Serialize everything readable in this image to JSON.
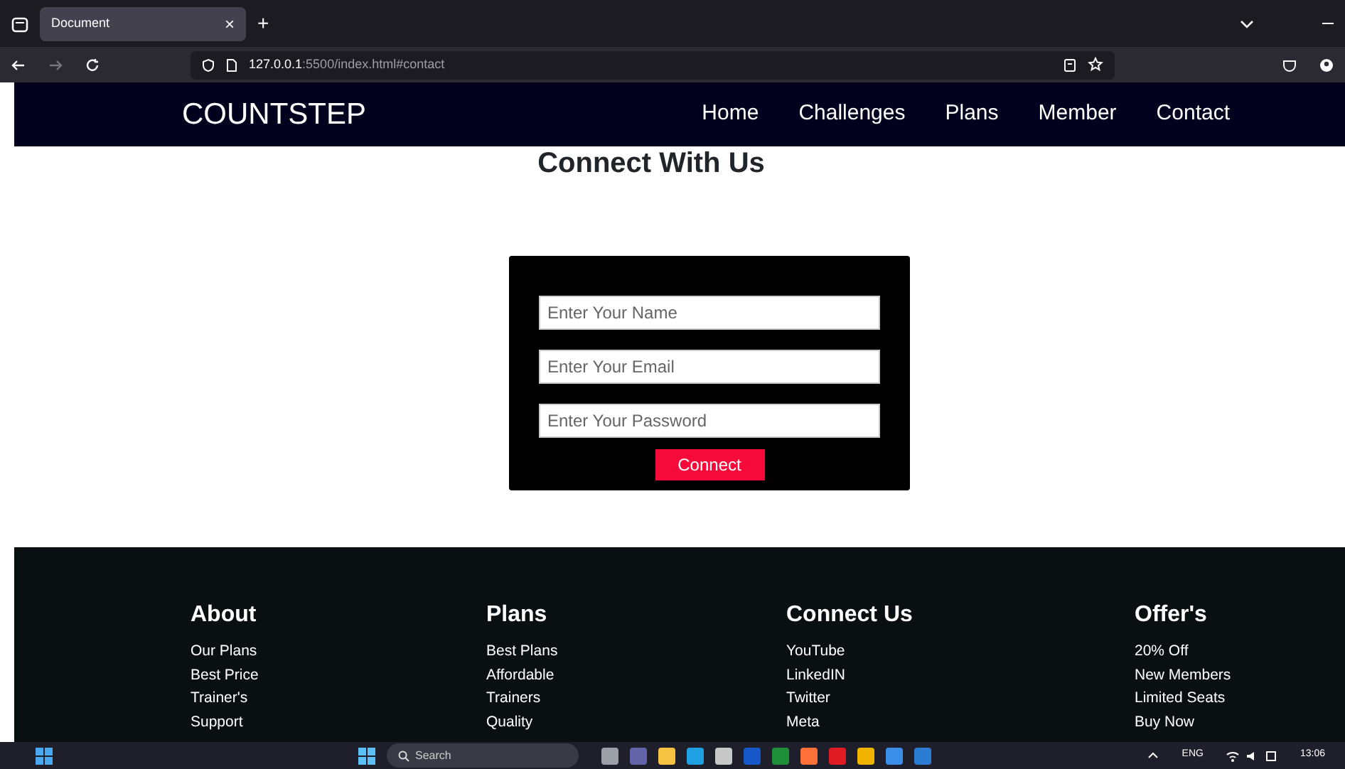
{
  "browser": {
    "tab_title": "Document",
    "tab_close": "×",
    "new_tab": "+",
    "url_host": "127.0.0.1",
    "url_path": ":5500/index.html#contact"
  },
  "navbar": {
    "brand": "COUNTSTEP",
    "links": [
      "Home",
      "Challenges",
      "Plans",
      "Member",
      "Contact"
    ]
  },
  "contact": {
    "title": "Connect With Us",
    "fields": [
      {
        "placeholder": "Enter Your Name"
      },
      {
        "placeholder": "Enter Your Email"
      },
      {
        "placeholder": "Enter Your Password"
      }
    ],
    "button": "Connect"
  },
  "footer": {
    "columns": [
      {
        "heading": "About",
        "links": [
          "Our Plans",
          "Best Price",
          "Trainer's",
          "Support"
        ]
      },
      {
        "heading": "Plans",
        "links": [
          "Best Plans",
          "Affordable",
          "Trainers",
          "Quality"
        ]
      },
      {
        "heading": "Connect Us",
        "links": [
          "YouTube",
          "LinkedIN",
          "Twitter",
          "Meta"
        ]
      },
      {
        "heading": "Offer's",
        "links": [
          "20% Off",
          "New Members",
          "Limited Seats",
          "Buy Now"
        ]
      }
    ]
  },
  "taskbar": {
    "search_placeholder": "Search",
    "language": "ENG",
    "time": "13:06"
  }
}
